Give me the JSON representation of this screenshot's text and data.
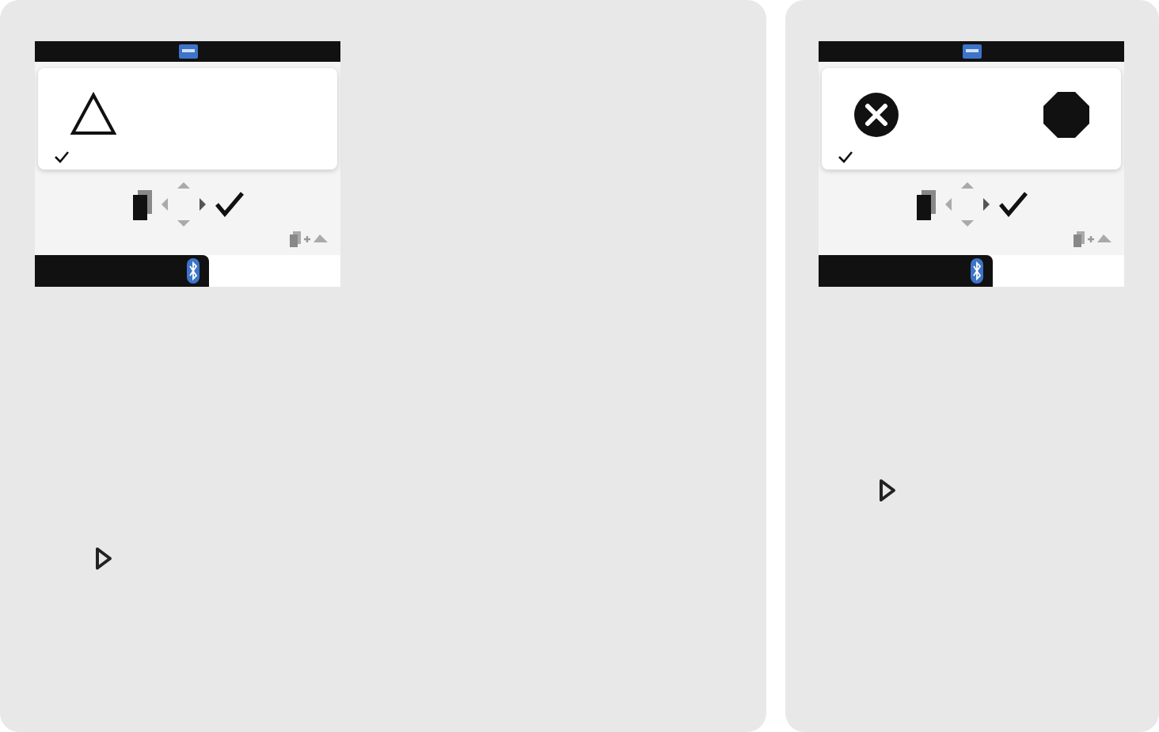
{
  "panels": [
    {
      "device_screen": {
        "symbols": [
          {
            "kind": "warning"
          }
        ],
        "checked": true
      }
    },
    {
      "device_screen": {
        "symbols": [
          {
            "kind": "error"
          },
          {
            "kind": "stop"
          }
        ],
        "checked": true
      }
    }
  ]
}
